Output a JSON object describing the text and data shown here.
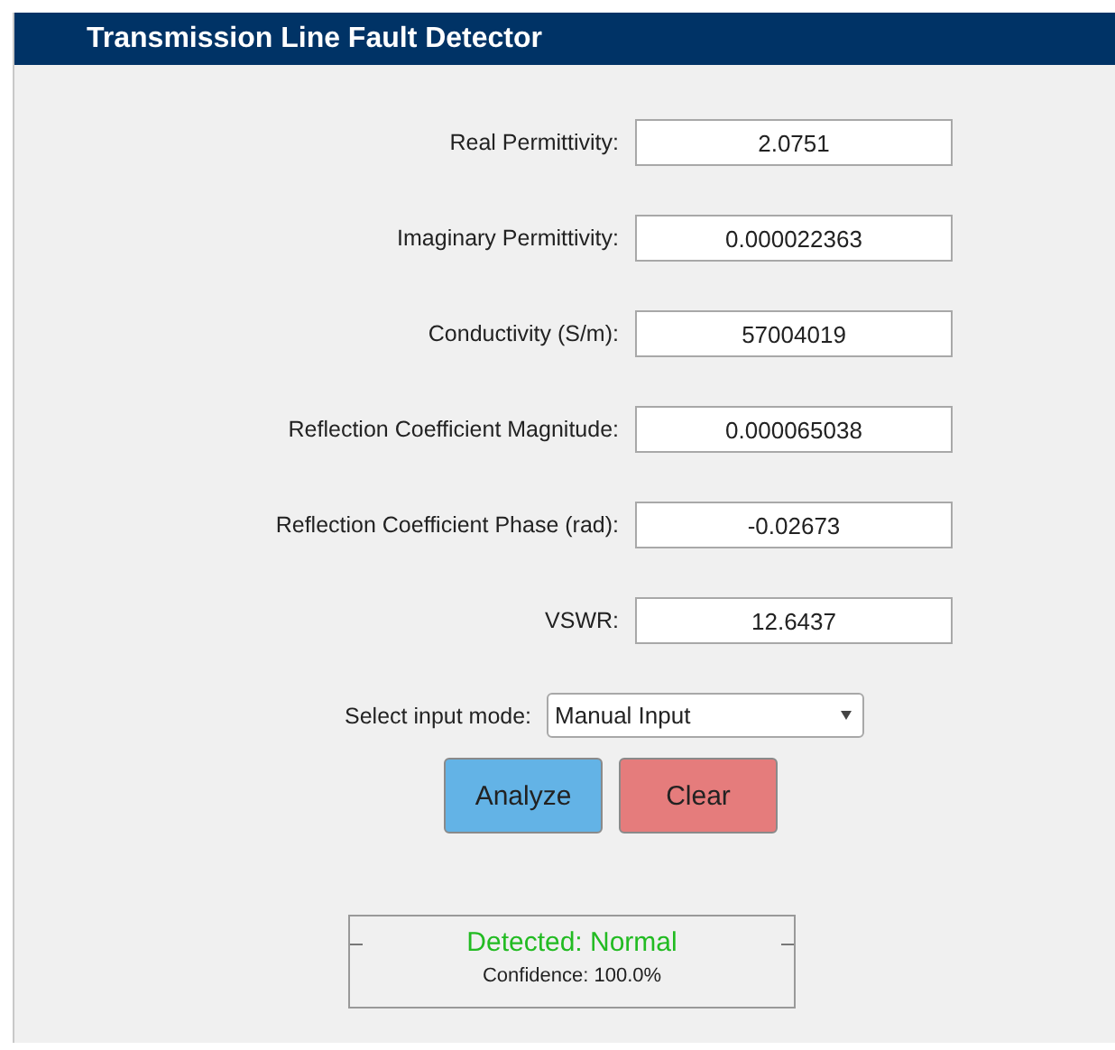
{
  "window": {
    "title": "Transmission Line Fault Detector"
  },
  "fields": [
    {
      "label": "Real Permittivity:",
      "value": "2.0751"
    },
    {
      "label": "Imaginary Permittivity:",
      "value": "0.000022363"
    },
    {
      "label": "Conductivity (S/m):",
      "value": "57004019"
    },
    {
      "label": "Reflection Coefficient Magnitude:",
      "value": "0.000065038"
    },
    {
      "label": "Reflection Coefficient Phase (rad):",
      "value": "-0.02673"
    },
    {
      "label": "VSWR:",
      "value": "12.6437"
    }
  ],
  "input_mode": {
    "label": "Select input mode:",
    "value": "Manual Input"
  },
  "buttons": [
    {
      "label": "Analyze",
      "kind": "primary"
    },
    {
      "label": "Clear",
      "kind": "danger"
    }
  ],
  "result": {
    "title": "Detected: Normal",
    "color": "#22bb22",
    "confidence": "Confidence: 100.0%"
  }
}
